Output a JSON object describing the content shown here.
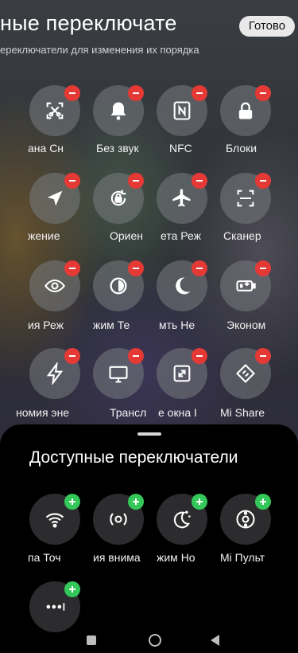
{
  "header": {
    "title": "ные переключате",
    "done_label": "Готово",
    "subtitle": "ереключатели для изменения их порядка"
  },
  "active_tiles": [
    {
      "label": "ана  Сн",
      "icon": "screenshot-icon"
    },
    {
      "label": "Без звук",
      "icon": "bell-icon"
    },
    {
      "label": "NFC",
      "icon": "nfc-icon"
    },
    {
      "label": "Блоки",
      "icon": "lock-icon"
    },
    {
      "label": "жение",
      "icon": "location-icon"
    },
    {
      "label": "Ориен",
      "icon": "rotation-icon"
    },
    {
      "label": "ета  Реж",
      "icon": "airplane-icon"
    },
    {
      "label": "Сканер",
      "icon": "scanner-icon"
    },
    {
      "label": "ия  Реж",
      "icon": "eye-icon"
    },
    {
      "label": "жим  Те",
      "icon": "contrast-icon"
    },
    {
      "label": "мть  Не",
      "icon": "moon-icon"
    },
    {
      "label": "Эконом",
      "icon": "battery-icon"
    },
    {
      "label": "номия эне",
      "icon": "bolt-icon"
    },
    {
      "label": "Трансл",
      "icon": "cast-icon"
    },
    {
      "label": "е окна  І",
      "icon": "resize-icon"
    },
    {
      "label": "Mi Share",
      "icon": "mi-share-icon"
    }
  ],
  "available": {
    "title": "Доступные переключатели",
    "tiles": [
      {
        "label": "па  Точ",
        "icon": "hotspot-icon"
      },
      {
        "label": "ия внима",
        "icon": "attention-icon"
      },
      {
        "label": "жим  Но",
        "icon": "night-mode-icon"
      },
      {
        "label": "Mi Пульт",
        "icon": "remote-icon"
      },
      {
        "label": "",
        "icon": "more-icon"
      }
    ]
  },
  "navbar": {
    "items": [
      "recents-icon",
      "home-icon",
      "back-icon"
    ]
  }
}
